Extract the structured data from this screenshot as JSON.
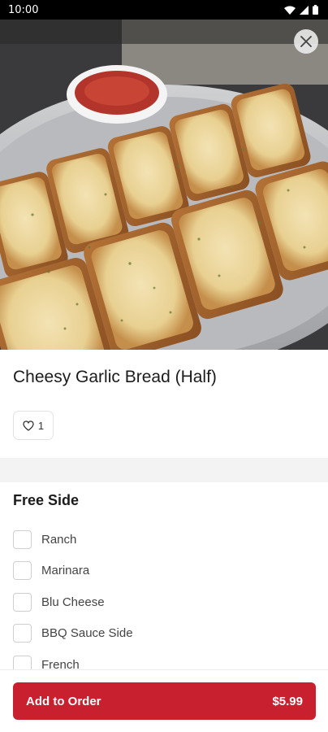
{
  "status_bar": {
    "time": "10:00"
  },
  "item": {
    "title": "Cheesy Garlic Bread (Half)",
    "likes": "1"
  },
  "free_side": {
    "title": "Free Side",
    "options": [
      {
        "label": "Ranch",
        "checked": false
      },
      {
        "label": "Marinara",
        "checked": false
      },
      {
        "label": "Blu Cheese",
        "checked": false
      },
      {
        "label": "BBQ Sauce Side",
        "checked": false
      },
      {
        "label": "French",
        "checked": false
      }
    ]
  },
  "footer": {
    "add_label": "Add to Order",
    "price": "$5.99"
  },
  "colors": {
    "brand": "#c8202f",
    "checkbox_border": "#cfcfcf",
    "section_bg": "#f3f3f3"
  }
}
